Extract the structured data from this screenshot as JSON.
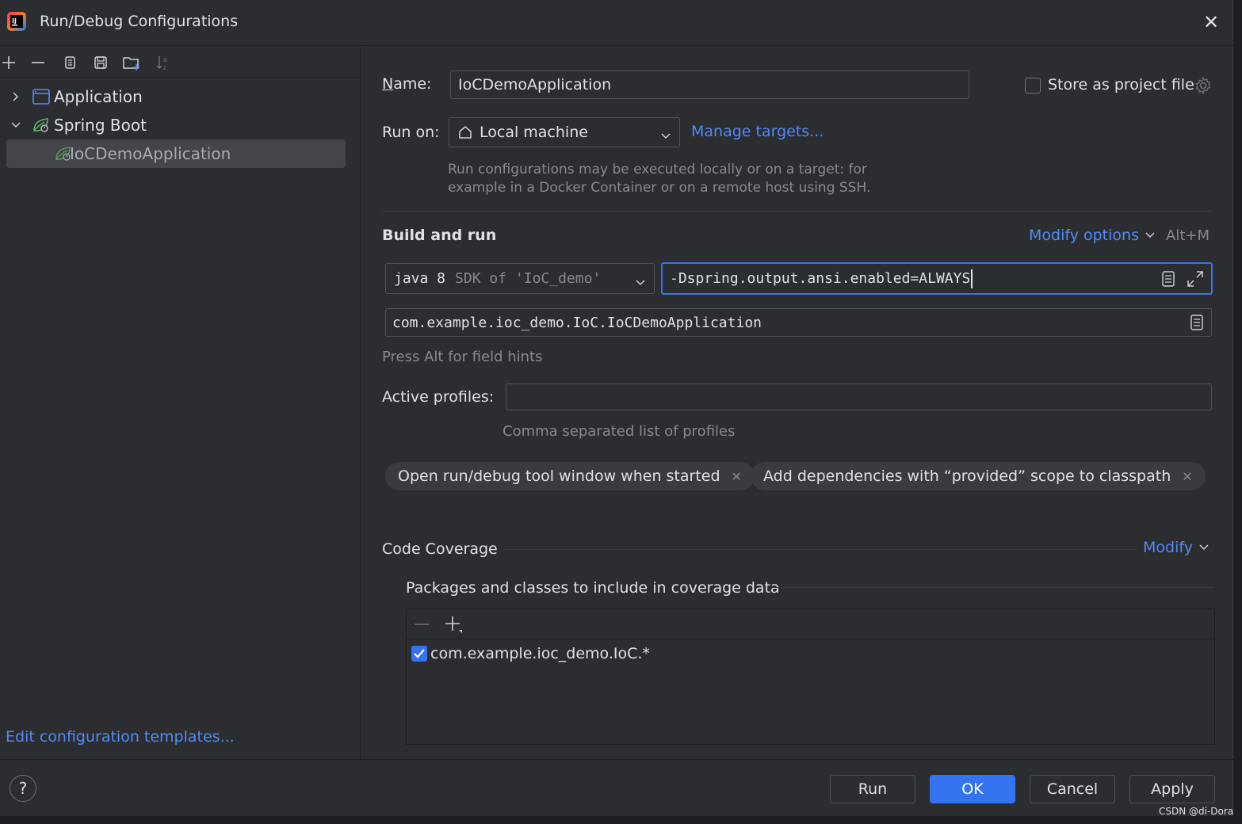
{
  "window": {
    "title": "Run/Debug Configurations",
    "close_glyph": "✕"
  },
  "toolbar": {
    "icons": [
      "add-icon",
      "remove-icon",
      "copy-icon",
      "save-icon",
      "new-folder-icon",
      "sort-icon"
    ]
  },
  "tree": {
    "items": [
      {
        "label": "Application",
        "icon": "application-icon",
        "expanded": false
      },
      {
        "label": "Spring Boot",
        "icon": "spring-boot-icon",
        "expanded": true
      },
      {
        "label": "IoCDemoApplication",
        "icon": "spring-boot-icon",
        "selected": true
      }
    ]
  },
  "left_footer": {
    "edit_templates": "Edit configuration templates..."
  },
  "form": {
    "name_label_prefix": "N",
    "name_label_rest": "ame:",
    "name_value": "IoCDemoApplication",
    "store_as_project_file": "Store as project file",
    "store_checked": false,
    "run_on_label": "Run on:",
    "run_on_value": "Local machine",
    "manage_targets": "Manage targets...",
    "run_on_hint_line1": "Run configurations may be executed locally or on a target: for",
    "run_on_hint_line2": "example in a Docker Container or on a remote host using SSH.",
    "build_and_run": "Build and run",
    "modify_options": "Modify options",
    "modify_shortcut": "Alt+M",
    "jdk_version": "java 8",
    "jdk_desc": "SDK of 'IoC_demo'",
    "vm_options": "-Dspring.output.ansi.enabled=ALWAYS",
    "main_class": "com.example.ioc_demo.IoC.IoCDemoApplication",
    "field_hint": "Press Alt for field hints",
    "active_profiles_label": "Active profiles:",
    "active_profiles_value": "",
    "active_profiles_hint": "Comma separated list of profiles",
    "chips": [
      "Open run/debug tool window when started",
      "Add dependencies with “provided” scope to classpath"
    ],
    "code_coverage": "Code Coverage",
    "modify": "Modify",
    "coverage_packages_title": "Packages and classes to include in coverage data",
    "coverage_items": [
      {
        "label": "com.example.ioc_demo.IoC.*",
        "checked": true
      }
    ]
  },
  "buttons": {
    "help": "?",
    "run": "Run",
    "ok": "OK",
    "cancel": "Cancel",
    "apply": "Apply"
  },
  "watermark": "CSDN @di-Dora",
  "colors": {
    "accent": "#3574f0",
    "link": "#548af7",
    "background": "#2b2d30"
  }
}
